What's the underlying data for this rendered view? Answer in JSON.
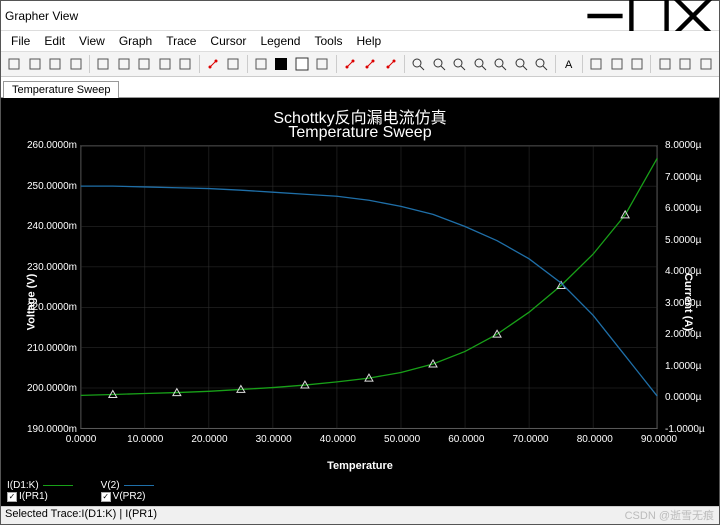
{
  "window": {
    "title": "Grapher View"
  },
  "menu": {
    "items": [
      "File",
      "Edit",
      "View",
      "Graph",
      "Trace",
      "Cursor",
      "Legend",
      "Tools",
      "Help"
    ]
  },
  "toolbar_icons": [
    "new-file",
    "open-file",
    "save",
    "print",
    "print-preview",
    "cut",
    "copy",
    "paste",
    "undo",
    "redo",
    "apply-filter",
    "table",
    "black-chart",
    "white-chart",
    "overlay",
    "red-marker-a",
    "red-dots",
    "red-marker-b",
    "zoom-in",
    "zoom-out",
    "zoom-fit",
    "zoom-x",
    "zoom-y",
    "zoom-region",
    "zoom-reset",
    "cursor-text",
    "filter",
    "wave",
    "export-trace",
    "sheet",
    "copy-sheet",
    "book"
  ],
  "tabs": {
    "active": "Temperature Sweep"
  },
  "chart": {
    "title1": "Schottky反向漏电流仿真",
    "title2": "Temperature Sweep",
    "xlabel": "Temperature",
    "ylabel_left": "Voltage (V)",
    "ylabel_right": "Current (A)"
  },
  "legend": {
    "s1_top": "I(D1:K)",
    "s1_bot": "I(PR1)",
    "s2_top": "V(2)",
    "s2_bot": "V(PR2)",
    "check": "✓"
  },
  "status": {
    "text": "Selected Trace:I(D1:K) | I(PR1)"
  },
  "watermark": "CSDN @逝雪无痕",
  "chart_data": {
    "type": "line",
    "xlabel": "Temperature",
    "ylabel_left": "Voltage (V)",
    "ylabel_right": "Current (A)",
    "x": [
      0,
      5,
      10,
      15,
      20,
      25,
      30,
      35,
      40,
      45,
      50,
      55,
      60,
      65,
      70,
      75,
      80,
      85,
      90
    ],
    "x_ticks": [
      "0.0000",
      "10.0000",
      "20.0000",
      "30.0000",
      "40.0000",
      "50.0000",
      "60.0000",
      "70.0000",
      "80.0000",
      "90.0000"
    ],
    "y_left_ticks": [
      "190.0000m",
      "200.0000m",
      "210.0000m",
      "220.0000m",
      "230.0000m",
      "240.0000m",
      "250.0000m",
      "260.0000m"
    ],
    "y_right_ticks": [
      "-1.0000µ",
      "0.0000µ",
      "1.0000µ",
      "2.0000µ",
      "3.0000µ",
      "4.0000µ",
      "5.0000µ",
      "6.0000µ",
      "7.0000µ",
      "8.0000µ"
    ],
    "xlim": [
      0,
      90
    ],
    "ylim_left": [
      190,
      260
    ],
    "ylim_right": [
      -1,
      8
    ],
    "series": [
      {
        "name": "I(D1:K) | I(PR1)",
        "axis": "right",
        "color": "#18a018",
        "markers": true,
        "values": [
          0.05,
          0.08,
          0.11,
          0.14,
          0.18,
          0.24,
          0.3,
          0.38,
          0.48,
          0.6,
          0.78,
          1.05,
          1.45,
          2.0,
          2.7,
          3.55,
          4.55,
          5.8,
          7.6
        ]
      },
      {
        "name": "V(2) | V(PR2)",
        "axis": "left",
        "color": "#1f6fa8",
        "markers": false,
        "values": [
          250,
          250,
          249.8,
          249.6,
          249.4,
          249.0,
          248.5,
          248.0,
          247.5,
          246.5,
          245.0,
          243.0,
          240.0,
          236.5,
          232.0,
          226.0,
          218.0,
          208.0,
          198.0
        ]
      }
    ]
  }
}
